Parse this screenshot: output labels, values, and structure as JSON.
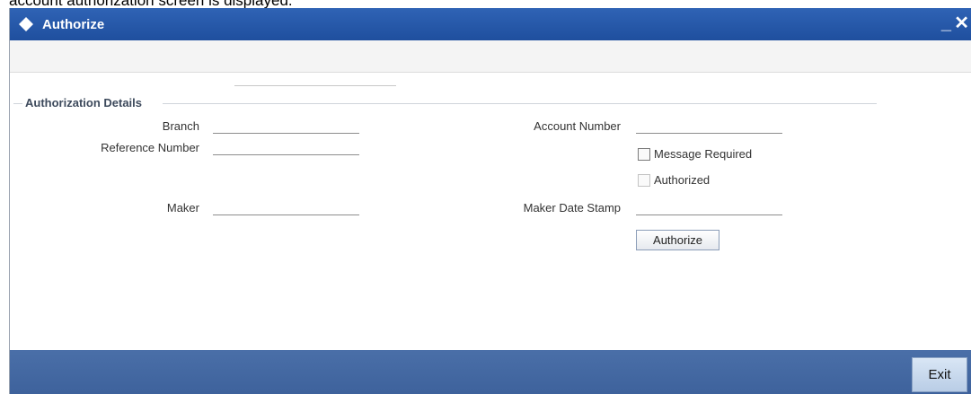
{
  "caption": "account authorization screen is displayed.",
  "window": {
    "title": "Authorize",
    "minimize_label": "_",
    "close_label": "✕"
  },
  "section": {
    "legend": "Authorization Details"
  },
  "form": {
    "branch_label": "Branch",
    "branch_value": "",
    "reference_label": "Reference Number",
    "reference_value": "",
    "maker_label": "Maker",
    "maker_value": "",
    "account_label": "Account Number",
    "account_value": "",
    "message_required_label": "Message Required",
    "message_required_checked": false,
    "authorized_label": "Authorized",
    "authorized_checked": false,
    "maker_date_label": "Maker Date Stamp",
    "maker_date_value": "",
    "authorize_button": "Authorize"
  },
  "footer": {
    "exit_label": "Exit"
  },
  "colors": {
    "title_bar": "#2659a9",
    "footer_bar": "#4467a0",
    "content_bg": "#ffffff"
  }
}
